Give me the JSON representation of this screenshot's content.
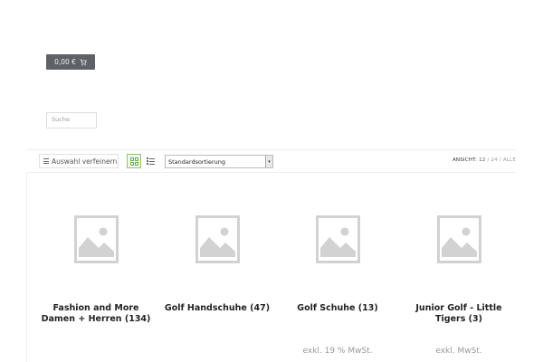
{
  "header": {
    "cart_label": "0,00 €",
    "cart_icon": "cart-icon"
  },
  "search": {
    "placeholder": "Suche"
  },
  "toolbar": {
    "refine_label": "Auswahl verfeinern",
    "sort_selected": "Standardsortierung",
    "view_label": "ANSICHT:",
    "view_option_1": "12",
    "view_sep_1": "/",
    "view_option_2": "24",
    "view_sep_2": "/",
    "view_option_3": "ALLE"
  },
  "categories": [
    {
      "title": "Fashion and More Damen + Herren (134)",
      "tax": ""
    },
    {
      "title": "Golf Handschuhe (47)",
      "tax": ""
    },
    {
      "title": "Golf Schuhe (13)",
      "tax": "exkl. 19 % MwSt."
    },
    {
      "title": "Junior Golf - Little Tigers (3)",
      "tax": "exkl. MwSt."
    }
  ],
  "colors": {
    "cart_bg": "#5e6168",
    "accent_green": "#8cc66e",
    "placeholder_grey": "#d2d2d2"
  }
}
